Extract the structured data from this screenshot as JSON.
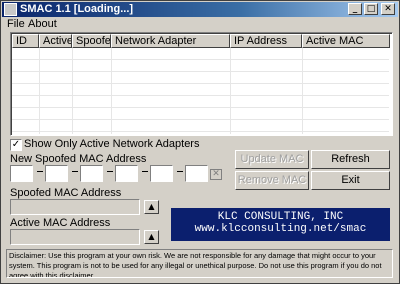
{
  "window": {
    "title": "SMAC 1.1  [Loading...]"
  },
  "menu": [
    "File",
    "About"
  ],
  "table": {
    "columns": [
      "ID",
      "Active",
      "Spoofed",
      "Network Adapter",
      "IP Address",
      "Active MAC"
    ],
    "rows": []
  },
  "show_only_active": {
    "label": "Show Only Active Network Adapters",
    "checked": true
  },
  "new_mac": {
    "label": "New Spoofed MAC Address",
    "segments": [
      "",
      "",
      "",
      "",
      "",
      ""
    ]
  },
  "buttons": {
    "update_mac": "Update MAC",
    "refresh": "Refresh",
    "remove_mac": "Remove MAC",
    "exit": "Exit"
  },
  "spoofed_mac": {
    "label": "Spoofed MAC Address",
    "value": ""
  },
  "active_mac": {
    "label": "Active MAC Address",
    "value": ""
  },
  "banner": {
    "line1": "KLC CONSULTING, INC",
    "line2": "www.klcconsulting.net/smac"
  },
  "disclaimer": "Disclaimer: Use this program at your own risk.  We are not responsible for any damage that might occur to your system.  This program is not to be used for any illegal or unethical purpose.  Do not use this program if you do not agree with this disclaimer."
}
